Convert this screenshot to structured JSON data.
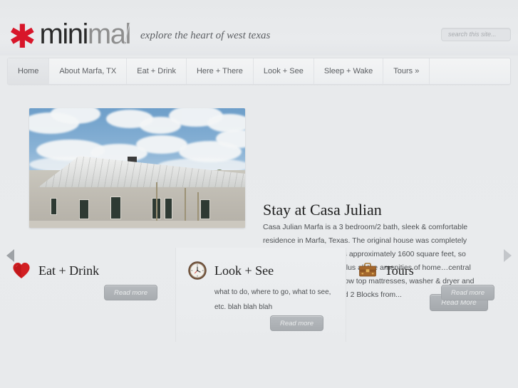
{
  "header": {
    "logo_mini": "mini",
    "logo_mal": "mal",
    "asterisk": "✳",
    "tagline": "explore the heart of west texas",
    "search_placeholder": "search this site...",
    "search_value": ""
  },
  "nav": {
    "items": [
      {
        "label": "Home",
        "active": true
      },
      {
        "label": "About Marfa, TX",
        "active": false
      },
      {
        "label": "Eat + Drink",
        "active": false
      },
      {
        "label": "Here + There",
        "active": false
      },
      {
        "label": "Look + See",
        "active": false
      },
      {
        "label": "Sleep + Wake",
        "active": false
      },
      {
        "label": "Tours »",
        "active": false
      }
    ]
  },
  "slider": {
    "title": "Stay at Casa Julian",
    "body": "Casa Julian Marfa is a 3 bedroom/2 bath, sleek & comfortable residence in Marfa, Texas. The original house was completely remodeled in 2009 and is approximately 1600 square feet, so there is plenty of space plus all the amenities of home…central heat & AC, European pillow top mattresses, washer & dryer and wireless Internet. Located 2 Blocks from...",
    "read_more_label": "Read More",
    "prev_arrow": "◀",
    "next_arrow": "▶",
    "dots": [
      {
        "active": false
      },
      {
        "active": true
      },
      {
        "active": false
      }
    ],
    "photo_alt": "White metal roof house under blue cloudy sky"
  },
  "columns": [
    {
      "icon": "heart-icon",
      "title": "Eat + Drink",
      "text": "",
      "read_more_label": "Read more"
    },
    {
      "icon": "clock-icon",
      "title": "Look + See",
      "text": "what to do, where to go, what to see, etc.  blah blah blah",
      "read_more_label": "Read more"
    },
    {
      "icon": "briefcase-icon",
      "title": "Tours",
      "text": "",
      "read_more_label": "Read more"
    }
  ],
  "colors": {
    "page_bg": "#e8eaec",
    "accent_red": "#d8162a",
    "text_dark": "#1f1f1f",
    "text_body": "#4e5154",
    "button_gray": "#a8acb0"
  }
}
